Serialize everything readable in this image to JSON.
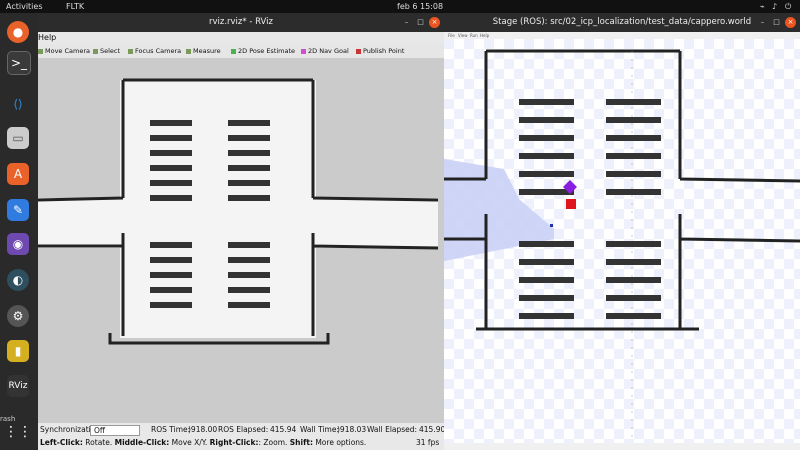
{
  "topbar": {
    "activities": "Activities",
    "app": "FLTK",
    "clock": "feb 6  15:08"
  },
  "dock": {
    "items": [
      {
        "icon": "firefox-icon"
      },
      {
        "icon": "terminal-icon"
      },
      {
        "icon": "vscode-icon"
      },
      {
        "icon": "files-icon"
      },
      {
        "icon": "app-store-icon"
      },
      {
        "icon": "text-editor-icon"
      },
      {
        "icon": "github-icon"
      },
      {
        "icon": "gnome-icon"
      },
      {
        "icon": "settings-icon"
      },
      {
        "icon": "battery-icon"
      },
      {
        "icon": "rviz-icon"
      },
      {
        "icon": "trash-icon"
      },
      {
        "icon": "show-apps-icon"
      }
    ],
    "rviz_label": "RViz",
    "trash_label": "rash"
  },
  "rviz": {
    "title": "rviz.rviz* - RViz",
    "menu": {
      "help": "Help"
    },
    "toolbar": {
      "move_camera": "Move Camera",
      "select": "Select",
      "focus_camera": "Focus Camera",
      "measure": "Measure",
      "pose_estimate": "2D Pose Estimate",
      "nav_goal": "2D Nav Goal",
      "publish_point": "Publish Point"
    },
    "status": {
      "sync_label": "Synchronization:",
      "sync_value": "Off",
      "ros_time_label": "ROS Time:",
      "ros_time": ")918.00",
      "ros_elapsed_label": "ROS Elapsed:",
      "ros_elapsed": "415.94",
      "wall_time_label": "Wall Time:",
      "wall_time": ")918.03",
      "wall_elapsed_label": "Wall Elapsed:",
      "wall_elapsed": "415.90"
    },
    "hint": {
      "left": "Left-Click:",
      "left_desc": " Rotate. ",
      "middle": "Middle-Click:",
      "middle_desc": " Move X/Y. ",
      "right": "Right-Click:",
      "right_desc": ": Zoom. ",
      "shift": "Shift:",
      "shift_desc": " More options.",
      "fps": "31 fps"
    }
  },
  "stage": {
    "title": "Stage (ROS): src/02_icp_localization/test_data/cappero.world",
    "menu": [
      "File",
      "View",
      "Run",
      "Help"
    ]
  },
  "colors": {
    "robot_red": "#e0161e",
    "robot_purple": "#8a1ee0",
    "laser_blue": "#c9d0f5",
    "map_dark": "#222222"
  }
}
